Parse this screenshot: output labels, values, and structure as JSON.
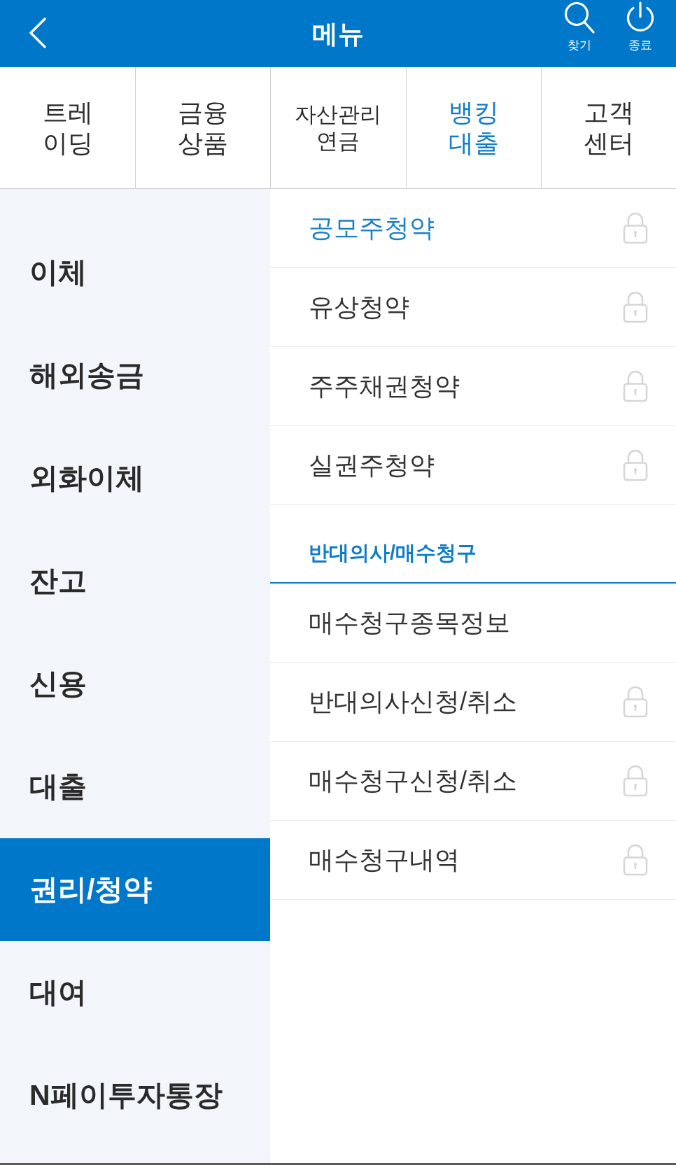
{
  "header": {
    "title": "메뉴",
    "actions": [
      {
        "kind": "search",
        "label": "찾기"
      },
      {
        "kind": "power",
        "label": "종료"
      }
    ]
  },
  "tabs": [
    {
      "lines": [
        "트레",
        "이딩"
      ],
      "selected": false
    },
    {
      "lines": [
        "금융",
        "상품"
      ],
      "selected": false
    },
    {
      "lines": [
        "자산관리",
        "연금"
      ],
      "selected": false
    },
    {
      "lines": [
        "뱅킹",
        "대출"
      ],
      "selected": true
    },
    {
      "lines": [
        "고객",
        "센터"
      ],
      "selected": false
    }
  ],
  "categories": [
    {
      "label": "이체",
      "selected": false
    },
    {
      "label": "해외송금",
      "selected": false
    },
    {
      "label": "외화이체",
      "selected": false
    },
    {
      "label": "잔고",
      "selected": false
    },
    {
      "label": "신용",
      "selected": false
    },
    {
      "label": "대출",
      "selected": false
    },
    {
      "label": "권리/청약",
      "selected": true
    },
    {
      "label": "대여",
      "selected": false
    },
    {
      "label": "N페이투자통장",
      "selected": false
    }
  ],
  "submenu": [
    {
      "kind": "item",
      "label": "공모주청약",
      "selected": true,
      "locked": true
    },
    {
      "kind": "item",
      "label": "유상청약",
      "selected": false,
      "locked": true
    },
    {
      "kind": "item",
      "label": "주주채권청약",
      "selected": false,
      "locked": true
    },
    {
      "kind": "item",
      "label": "실권주청약",
      "selected": false,
      "locked": true
    },
    {
      "kind": "section",
      "label": "반대의사/매수청구"
    },
    {
      "kind": "item",
      "label": "매수청구종목정보",
      "selected": false,
      "locked": false
    },
    {
      "kind": "item",
      "label": "반대의사신청/취소",
      "selected": false,
      "locked": true
    },
    {
      "kind": "item",
      "label": "매수청구신청/취소",
      "selected": false,
      "locked": true
    },
    {
      "kind": "item",
      "label": "매수청구내역",
      "selected": false,
      "locked": true
    }
  ]
}
